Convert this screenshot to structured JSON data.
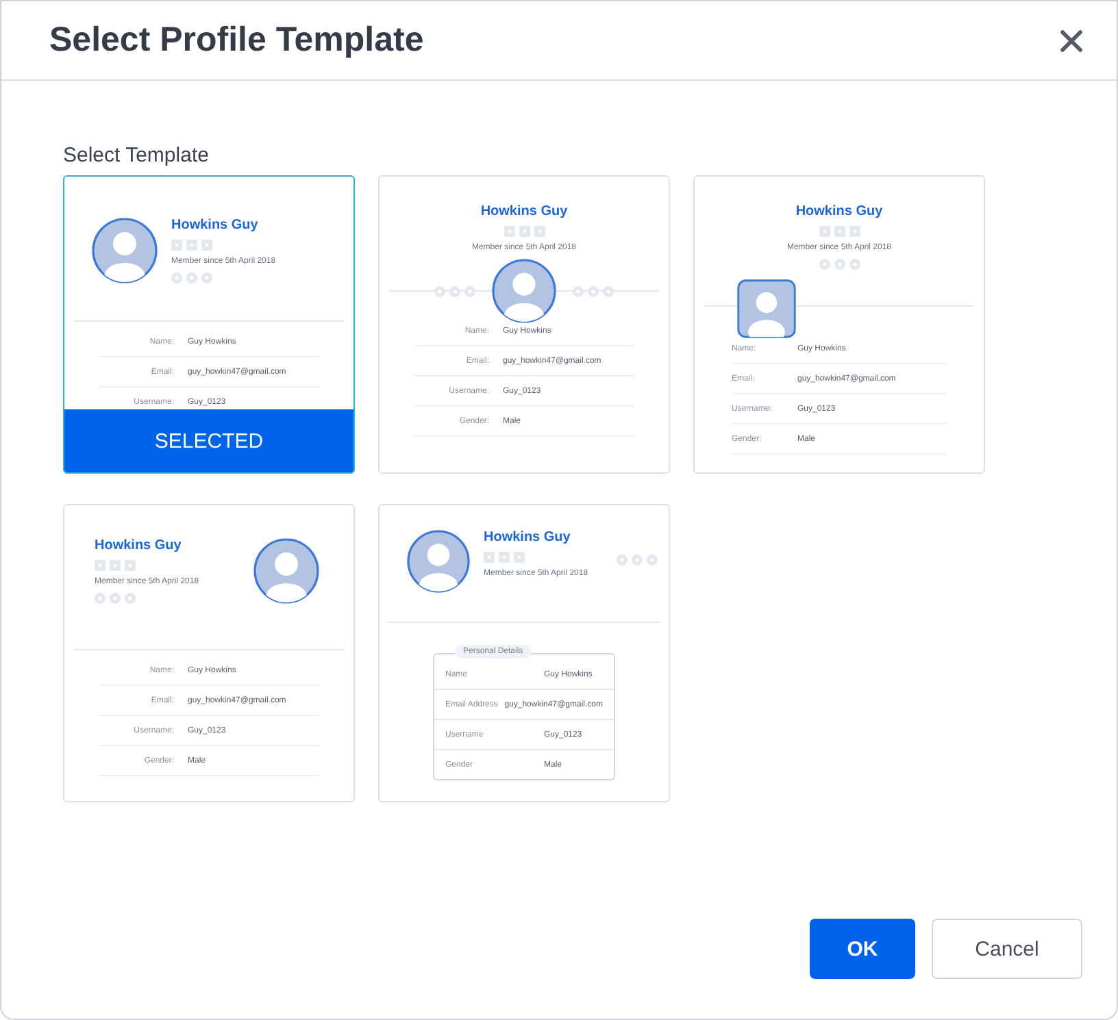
{
  "dialog": {
    "title": "Select Profile Template",
    "section_label": "Select Template",
    "selected_badge": "SELECTED",
    "templates": [
      {
        "kind": "left",
        "selected": true,
        "name": "Howkins Guy",
        "member_since": "Member since 5th April 2018",
        "fields": [
          {
            "label": "Name:",
            "value": "Guy Howkins"
          },
          {
            "label": "Email:",
            "value": "guy_howkin47@gmail.com"
          },
          {
            "label": "Username:",
            "value": "Guy_0123"
          }
        ]
      },
      {
        "kind": "center",
        "selected": false,
        "name": "Howkins Guy",
        "member_since": "Member since 5th April 2018",
        "fields": [
          {
            "label": "Name:",
            "value": "Guy Howkins"
          },
          {
            "label": "Email:",
            "value": "guy_howkin47@gmail.com"
          },
          {
            "label": "Username:",
            "value": "Guy_0123"
          },
          {
            "label": "Gender:",
            "value": "Male"
          }
        ]
      },
      {
        "kind": "square",
        "selected": false,
        "name": "Howkins Guy",
        "member_since": "Member since 5th April 2018",
        "fields": [
          {
            "label": "Name:",
            "value": "Guy Howkins"
          },
          {
            "label": "Email:",
            "value": "guy_howkin47@gmail.com"
          },
          {
            "label": "Username:",
            "value": "Guy_0123"
          },
          {
            "label": "Gender:",
            "value": "Male"
          }
        ]
      },
      {
        "kind": "right",
        "selected": false,
        "name": "Howkins Guy",
        "member_since": "Member since 5th April 2018",
        "fields": [
          {
            "label": "Name:",
            "value": "Guy Howkins"
          },
          {
            "label": "Email:",
            "value": "guy_howkin47@gmail.com"
          },
          {
            "label": "Username:",
            "value": "Guy_0123"
          },
          {
            "label": "Gender:",
            "value": "Male"
          }
        ]
      },
      {
        "kind": "boxed",
        "selected": false,
        "name": "Howkins Guy",
        "member_since": "Member since 5th April 2018",
        "legend": "Personal Details",
        "fields": [
          {
            "label": "Name",
            "value": "Guy Howkins"
          },
          {
            "label": "Email Address",
            "value": "guy_howkin47@gmail.com"
          },
          {
            "label": "Username",
            "value": "Guy_0123"
          },
          {
            "label": "Gender",
            "value": "Male"
          }
        ]
      }
    ],
    "buttons": [
      {
        "label": "OK",
        "kind": "primary"
      },
      {
        "label": "Cancel",
        "kind": "secondary"
      }
    ]
  }
}
